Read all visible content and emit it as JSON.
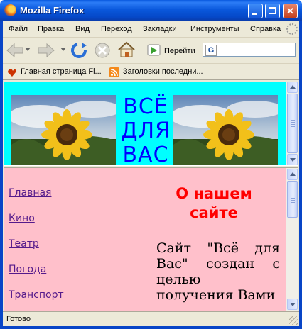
{
  "window": {
    "title": "Mozilla Firefox"
  },
  "menu": [
    "Файл",
    "Правка",
    "Вид",
    "Переход",
    "Закладки",
    "Инструменты",
    "Справка"
  ],
  "toolbar": {
    "go_label": "Перейти",
    "address_value": ""
  },
  "bookmarks": [
    "Главная страница Fi...",
    "Заголовки последни..."
  ],
  "banner": {
    "text_lines": [
      "ВСЁ",
      "ДЛЯ",
      "ВАС"
    ],
    "bg_color": "#00ffff",
    "text_color": "#0000ff"
  },
  "nav": {
    "links": [
      "Главная",
      "Кино",
      "Театр",
      "Погода",
      "Транспорт"
    ],
    "bg_color": "#ffc0cb",
    "link_color": "#551a8b"
  },
  "about": {
    "title": "О нашем сайте",
    "text": "Сайт \"Всё для Вас\" создан с целью получения Вами",
    "title_color": "#ff0000"
  },
  "status": {
    "text": "Готово"
  }
}
